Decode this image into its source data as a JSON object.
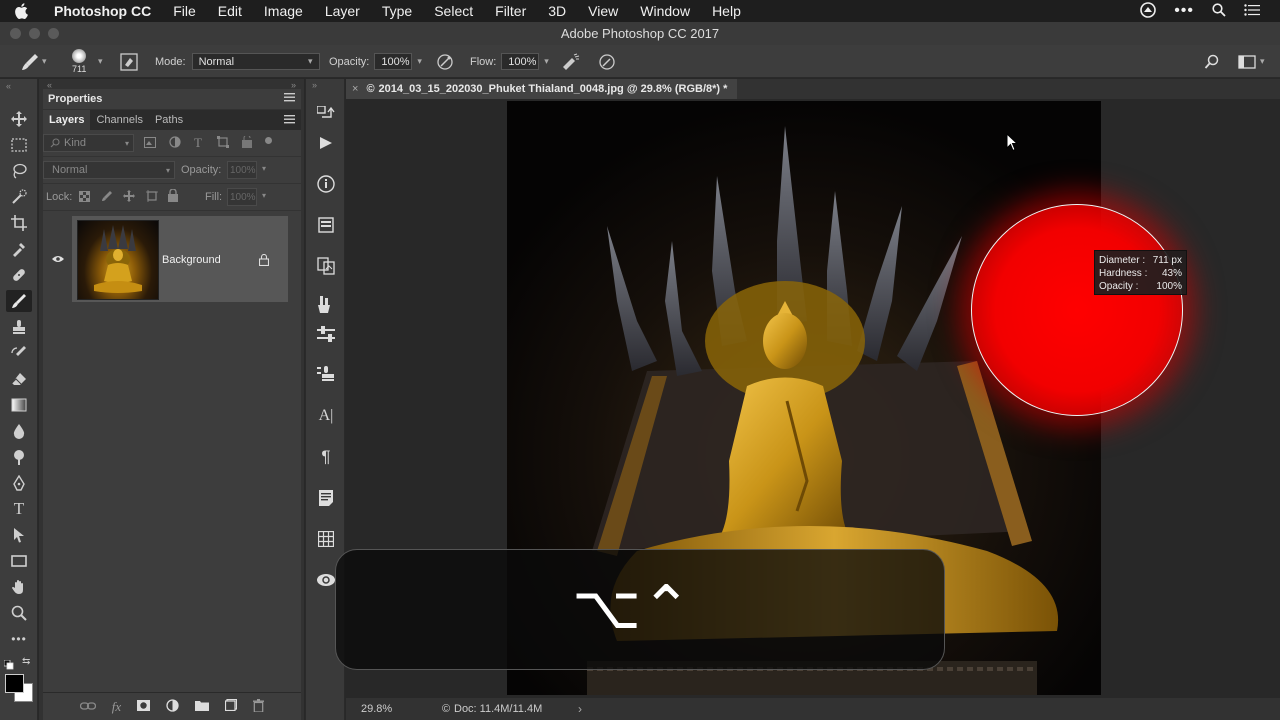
{
  "menubar": {
    "app_name": "Photoshop CC",
    "items": [
      "File",
      "Edit",
      "Image",
      "Layer",
      "Type",
      "Select",
      "Filter",
      "3D",
      "View",
      "Window",
      "Help"
    ]
  },
  "window": {
    "title": "Adobe Photoshop CC 2017"
  },
  "options": {
    "brush_size": "711",
    "mode_label": "Mode:",
    "mode_value": "Normal",
    "opacity_label": "Opacity:",
    "opacity_value": "100%",
    "flow_label": "Flow:",
    "flow_value": "100%"
  },
  "panel": {
    "properties_title": "Properties",
    "tabs": [
      "Layers",
      "Channels",
      "Paths"
    ],
    "kind_placeholder": "Kind",
    "blend_mode": "Normal",
    "opacity_label": "Opacity:",
    "opacity_value": "100%",
    "lock_label": "Lock:",
    "fill_label": "Fill:",
    "fill_value": "100%",
    "layer_name": "Background"
  },
  "document": {
    "tab_title": "2014_03_15_202030_Phuket Thialand_0048.jpg @ 29.8% (RGB/8*) *",
    "zoom": "29.8%",
    "doc_size": "Doc: 11.4M/11.4M"
  },
  "brush_info": {
    "diameter_label": "Diameter :",
    "diameter_value": "711 px",
    "hardness_label": "Hardness :",
    "hardness_value": "43%",
    "opacity_label": "Opacity :",
    "opacity_value": "100%"
  },
  "key_overlay": {
    "keys": "⌥⌃"
  },
  "colors": {
    "brush_color": "#ff0000",
    "gold": "#d4a11d"
  }
}
